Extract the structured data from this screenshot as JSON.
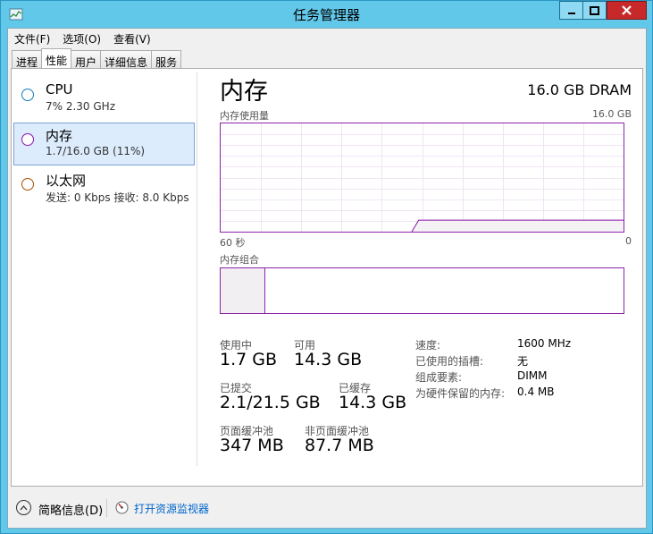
{
  "window": {
    "title": "任务管理器"
  },
  "menu": [
    "文件(F)",
    "选项(O)",
    "查看(V)"
  ],
  "tabs": [
    "进程",
    "性能",
    "用户",
    "详细信息",
    "服务"
  ],
  "sidebar": {
    "items": [
      {
        "name": "CPU",
        "sub": "7%  2.30 GHz",
        "color": "#117dbb"
      },
      {
        "name": "内存",
        "sub": "1.7/16.0 GB (11%)",
        "color": "#8b12ae"
      },
      {
        "name": "以太网",
        "sub": "发送: 0 Kbps  接收: 8.0 Kbps",
        "color": "#a74f01"
      }
    ]
  },
  "main": {
    "title": "内存",
    "subtitle": "16.0 GB DRAM",
    "usage_label": "内存使用量",
    "usage_max": "16.0 GB",
    "time_left": "60 秒",
    "time_right": "0",
    "composition_label": "内存组合"
  },
  "chart_data": {
    "type": "area",
    "title": "内存使用量",
    "x_labels": [
      "60 秒",
      "0"
    ],
    "ylim": [
      0,
      16.0
    ],
    "y_unit": "GB",
    "series": [
      {
        "values": [
          0,
          0,
          0,
          0,
          0,
          0,
          0,
          0,
          0,
          0,
          0,
          0,
          0,
          0,
          0,
          0,
          0,
          0,
          0,
          0,
          0,
          0,
          0,
          0,
          0,
          0,
          0,
          0,
          0,
          1.7,
          1.7,
          1.7,
          1.7,
          1.7,
          1.7,
          1.7,
          1.7,
          1.7,
          1.7,
          1.7,
          1.7,
          1.7,
          1.7,
          1.7,
          1.7,
          1.7,
          1.7,
          1.7,
          1.7,
          1.7,
          1.7,
          1.7,
          1.7,
          1.7,
          1.7,
          1.7,
          1.7,
          1.7,
          1.7,
          1.7
        ]
      }
    ],
    "grid": true,
    "color": "#8b12ae"
  },
  "composition": {
    "in_use_fraction": 0.11
  },
  "stats": {
    "in_use_label": "使用中",
    "in_use": "1.7 GB",
    "available_label": "可用",
    "available": "14.3 GB",
    "committed_label": "已提交",
    "committed": "2.1/21.5 GB",
    "cached_label": "已缓存",
    "cached": "14.3 GB",
    "paged_label": "页面缓冲池",
    "paged": "347 MB",
    "nonpaged_label": "非页面缓冲池",
    "nonpaged": "87.7 MB"
  },
  "details": [
    {
      "label": "速度:",
      "value": "1600 MHz"
    },
    {
      "label": "已使用的插槽:",
      "value": "无"
    },
    {
      "label": "组成要素:",
      "value": "DIMM"
    },
    {
      "label": "为硬件保留的内存:",
      "value": "0.4 MB"
    }
  ],
  "footer": {
    "fewer_details": "简略信息(D)",
    "resource_monitor": "打开资源监视器"
  }
}
